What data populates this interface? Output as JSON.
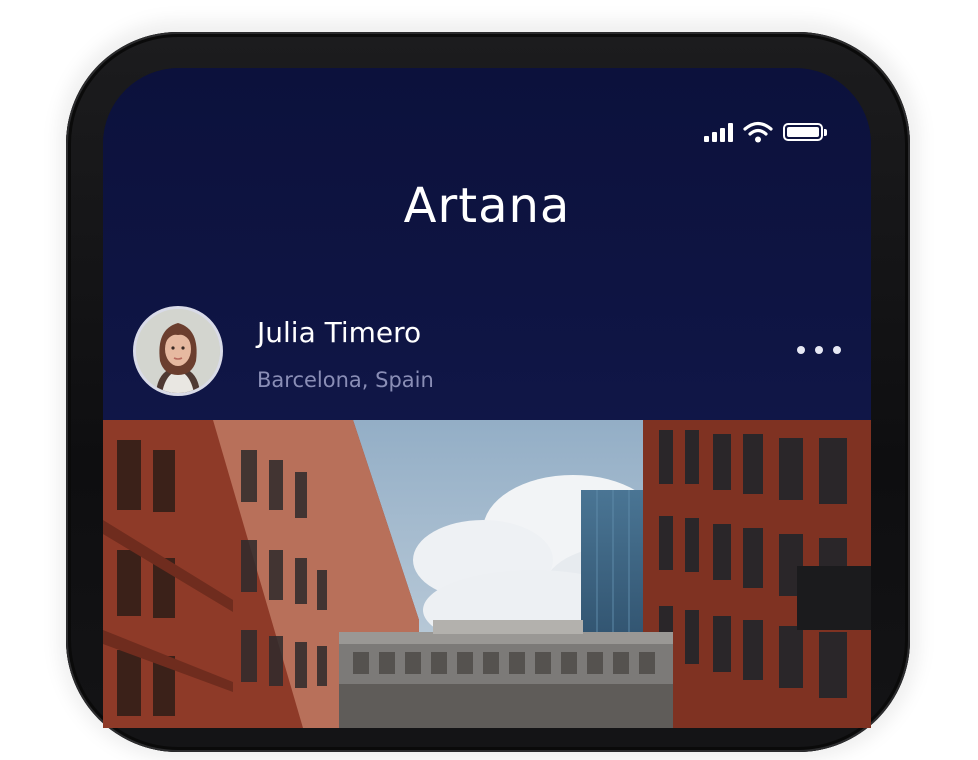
{
  "app": {
    "title": "Artana"
  },
  "status_bar": {
    "icons": [
      "signal-icon",
      "wifi-icon",
      "battery-icon"
    ],
    "battery_level": 1.0
  },
  "profile": {
    "name": "Julia Timero",
    "location": "Barcelona, Spain",
    "avatar_icon": "avatar",
    "menu_icon": "more-horizontal-icon"
  },
  "post": {
    "image": "city-street-photo"
  },
  "colors": {
    "header_bg": "#0c113c",
    "location_text": "#8a8eb6",
    "brick": "#8e3a28",
    "sky": "#a9bdcf"
  }
}
